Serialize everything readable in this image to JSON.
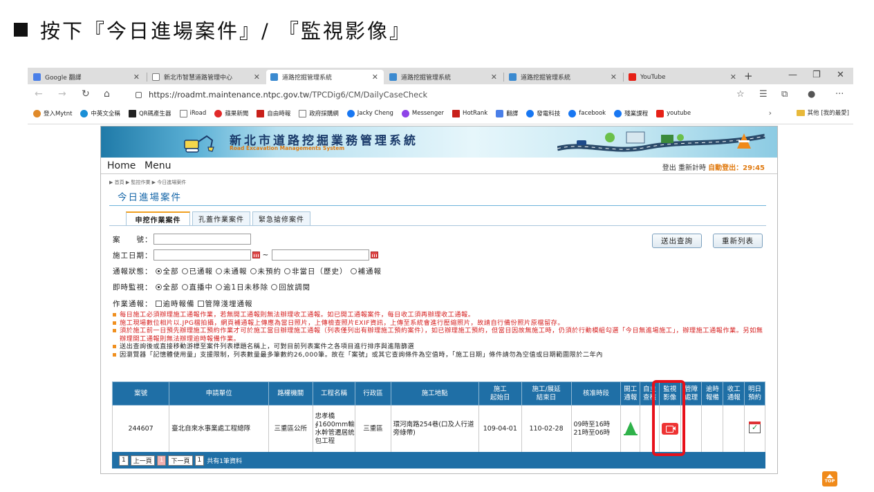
{
  "slide": {
    "title": "按下『今日進場案件』/ 『監視影像』"
  },
  "browser": {
    "tabs": [
      {
        "label": "Google 翻譯",
        "color": "#4a7fe8"
      },
      {
        "label": "新北市智慧道路管理中心",
        "color": "#888888"
      },
      {
        "label": "道路挖掘管理系統",
        "color": "#3b8ad0"
      },
      {
        "label": "道路挖掘管理系統",
        "color": "#3b8ad0"
      },
      {
        "label": "道路挖掘管理系統",
        "color": "#3b8ad0"
      },
      {
        "label": "YouTube",
        "color": "#e62117"
      }
    ],
    "url_host": "https://roadmt.maintenance.ntpc.gov.tw",
    "url_path": "/TPCDig6/CM/DailyCaseCheck",
    "bookmarks": [
      {
        "label": "登入Mytnt",
        "color": "#e08a2a"
      },
      {
        "label": "中英文全稱",
        "color": "#1a8fd6"
      },
      {
        "label": "QR碼產生器",
        "color": "#222222"
      },
      {
        "label": "iRoad",
        "color": "#888888"
      },
      {
        "label": "蘋果新聞",
        "color": "#e12a2a"
      },
      {
        "label": "自由時報",
        "color": "#c8201a"
      },
      {
        "label": "政府採購網",
        "color": "#888888"
      },
      {
        "label": "Jacky Cheng",
        "color": "#1877f2"
      },
      {
        "label": "Messenger",
        "color": "#8e44e8"
      },
      {
        "label": "HotRank",
        "color": "#c8201a"
      },
      {
        "label": "翻譯",
        "color": "#4a7fe8"
      },
      {
        "label": "發電科技",
        "color": "#1877f2"
      },
      {
        "label": "facebook",
        "color": "#1877f2"
      },
      {
        "label": "殘業課程",
        "color": "#1877f2"
      },
      {
        "label": "youtube",
        "color": "#e62117"
      }
    ],
    "other_bookmarks": "其他 [我的最愛]"
  },
  "site": {
    "title": "新北市道路挖掘業務管理系統",
    "subtitle": "Road Excavation Managements System",
    "menu_home": "Home",
    "menu_menu": "Menu",
    "topright_links": "登出  重新計時 ",
    "auto_logout": "自動登出：29:45",
    "breadcrumb": "▶ 首頁 ▶ 監控作業 ▶ 今日進場案件",
    "page_title": "今日進場案件",
    "tabs": [
      "申挖作業案件",
      "孔蓋作業案件",
      "緊急搶修案件"
    ],
    "form": {
      "case_no_label": "案　　號：",
      "date_label": "施工日期：",
      "date_sep": "~",
      "report_label": "通報狀態：",
      "report_options": [
        "全部",
        "已通報",
        "未通報",
        "未預約",
        "非當日（歷史）",
        "補通報"
      ],
      "monitor_label": "即時監視：",
      "monitor_options": [
        "全部",
        "直播中",
        "逾1日未移除",
        "回放調閱"
      ],
      "notify_label": "作業通報：",
      "notify_options": [
        "逾時報備",
        "管障淺埋通報"
      ]
    },
    "buttons": {
      "query": "送出查詢",
      "reset": "重新列表"
    },
    "notes": [
      {
        "color": "red",
        "text": "每日施工必須辦理施工通報作業，若無開工通報則無法辦理收工通報。如已開工通報案件，每日收工須再辦理收工通報。"
      },
      {
        "color": "red",
        "text": "施工現場數位相片以.JPG檔拍攝，網頁補通報上傳應為當日照片，上傳檢查照片EXIF資訊，上傳至系統會進行壓縮照片，故請自行備份照片原檔留存。"
      },
      {
        "color": "red",
        "text": "須於施工前一日預先辦理施工預約作業才可於施工當日辦理施工通報（列表僅列出有辦理施工預約案件），如已辦理施工預約，但當日因故無施工時，仍須於行動模組勾選「今日無進場施工」，辦理施工通報作業。另如無辦理開工通報則無法辦理逾時報備作業。"
      },
      {
        "color": "black",
        "text": "送出查詢後或直接移動游標至案件列表標題名稱上，可對目前列表案件之各項目進行排序與進階篩選"
      },
      {
        "color": "black",
        "text": "因瀏覽器「記憶體使用量」支援限制，列表數量最多筆數約26,000筆。故在「案號」或其它查詢條件為空值時，「施工日期」條件請勿為空值或日期範圍限於二年內"
      }
    ],
    "table": {
      "headers": [
        "案號",
        "申請單位",
        "路權機關",
        "工程名稱",
        "行政區",
        "施工地點",
        "施工\n起始日",
        "施工/展延\n結束日",
        "核准時段",
        "開工\n通報",
        "自主\n查核",
        "監視\n影像",
        "管障\n處理",
        "逾時\n報備",
        "收工\n通報",
        "明日\n預約"
      ],
      "rows": [
        {
          "case_no": "244607",
          "applicant": "臺北自來水事業處工程總隊",
          "authority": "三重區公所",
          "project": "忠孝橋∮1600mm輸水幹管遷居統包工程",
          "district": "三重區",
          "location": "環河南路254巷(口及人行道旁綠帶)",
          "start": "109-04-01",
          "end": "110-02-28",
          "slot": "09時至16時\n21時至06時"
        }
      ]
    },
    "pager": {
      "first": "1",
      "prev": "上一頁",
      "current": "1",
      "next": "下一頁",
      "last": "1",
      "info": "共有1筆資料"
    }
  },
  "top_button": "TOP"
}
